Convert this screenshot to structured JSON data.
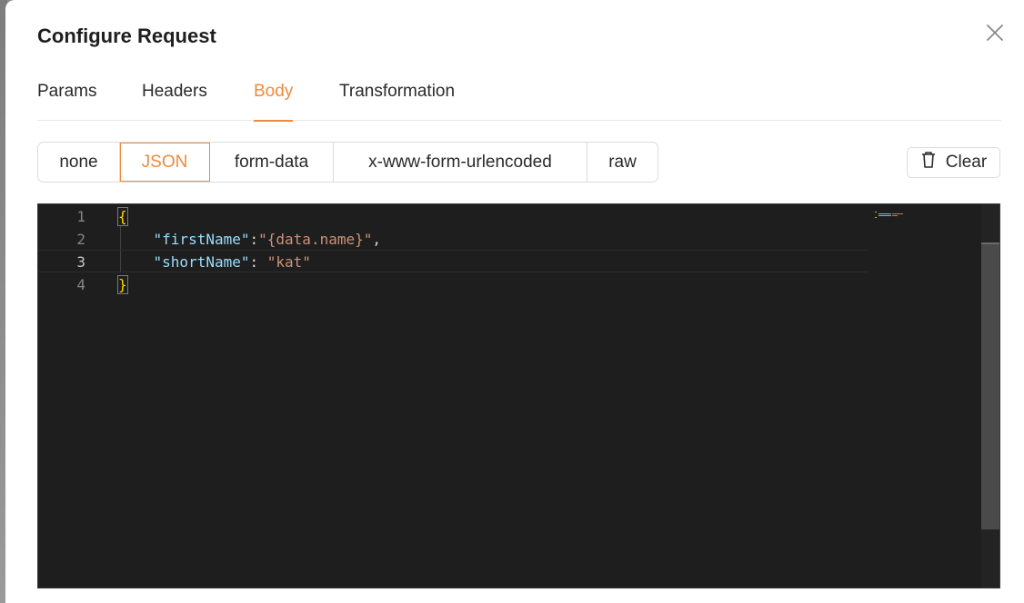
{
  "dialog": {
    "title": "Configure Request"
  },
  "tabs": [
    {
      "label": "Params",
      "active": false
    },
    {
      "label": "Headers",
      "active": false
    },
    {
      "label": "Body",
      "active": true
    },
    {
      "label": "Transformation",
      "active": false
    }
  ],
  "body_types": [
    {
      "label": "none",
      "active": false
    },
    {
      "label": "JSON",
      "active": true
    },
    {
      "label": "form-data",
      "active": false
    },
    {
      "label": "x-www-form-urlencoded",
      "active": false
    },
    {
      "label": "raw",
      "active": false
    }
  ],
  "clear_button": {
    "label": "Clear",
    "icon": "trash-icon"
  },
  "editor": {
    "line_numbers": [
      "1",
      "2",
      "3",
      "4"
    ],
    "current_line": 3,
    "lines": {
      "l1": {
        "brace": "{"
      },
      "l2": {
        "key": "\"firstName\"",
        "sep": ":",
        "value": "\"{data.name}\"",
        "trail": ","
      },
      "l3": {
        "key": "\"shortName\"",
        "sep": ": ",
        "value": "\"kat\""
      },
      "l4": {
        "brace": "}"
      }
    }
  },
  "colors": {
    "accent": "#f08a3c",
    "editor_bg": "#1e1e1e",
    "json_key": "#9cdcfe",
    "json_string": "#ce9178",
    "brace": "#ffd700"
  },
  "icons": {
    "close": "close-icon",
    "clear": "trash-icon"
  }
}
